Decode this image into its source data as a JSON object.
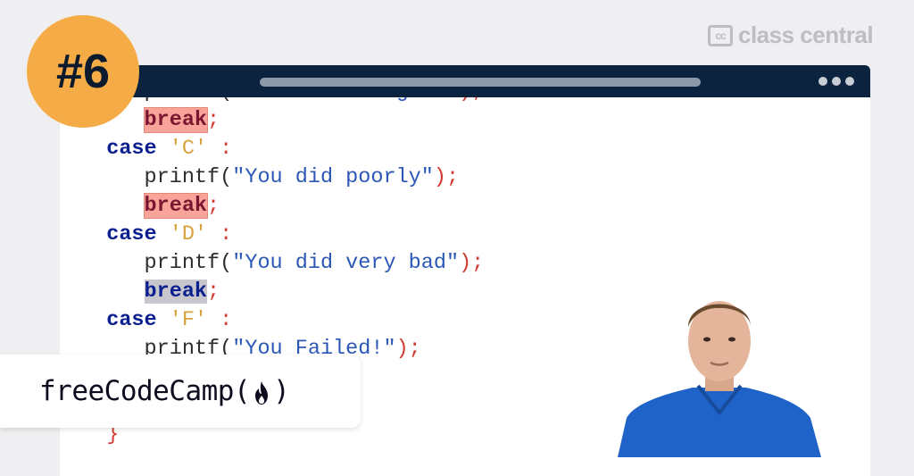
{
  "brand": {
    "cc_mark": "cc",
    "name": "class central"
  },
  "episode": {
    "label": "#6"
  },
  "editor": {
    "lines": [
      {
        "indent": "     ",
        "tokens": [
          {
            "t": "printf(",
            "c": "fn"
          },
          {
            "t": "\"You did alright!\"",
            "c": "str"
          },
          {
            "t": ");",
            "c": "pn"
          }
        ]
      },
      {
        "indent": "     ",
        "tokens": [
          {
            "t": "break",
            "c": "hl-red"
          },
          {
            "t": ";",
            "c": "pn"
          }
        ]
      },
      {
        "indent": "  ",
        "tokens": [
          {
            "t": "case",
            "c": "kw"
          },
          {
            "t": " 'C'",
            "c": "chr"
          },
          {
            "t": " :",
            "c": "pn"
          }
        ]
      },
      {
        "indent": "     ",
        "tokens": [
          {
            "t": "printf(",
            "c": "fn"
          },
          {
            "t": "\"You did poorly\"",
            "c": "str"
          },
          {
            "t": ");",
            "c": "pn"
          }
        ]
      },
      {
        "indent": "     ",
        "tokens": [
          {
            "t": "break",
            "c": "hl-red"
          },
          {
            "t": ";",
            "c": "pn"
          }
        ]
      },
      {
        "indent": "  ",
        "tokens": [
          {
            "t": "case",
            "c": "kw"
          },
          {
            "t": " 'D'",
            "c": "chr"
          },
          {
            "t": " :",
            "c": "pn"
          }
        ]
      },
      {
        "indent": "     ",
        "tokens": [
          {
            "t": "printf(",
            "c": "fn"
          },
          {
            "t": "\"You did very bad\"",
            "c": "str"
          },
          {
            "t": ");",
            "c": "pn"
          }
        ]
      },
      {
        "indent": "     ",
        "tokens": [
          {
            "t": "break",
            "c": "hl-grey"
          },
          {
            "t": ";",
            "c": "pn"
          }
        ]
      },
      {
        "indent": "  ",
        "tokens": [
          {
            "t": "case",
            "c": "kw"
          },
          {
            "t": " 'F'",
            "c": "chr"
          },
          {
            "t": " :",
            "c": "pn"
          }
        ]
      },
      {
        "indent": "     ",
        "tokens": [
          {
            "t": "printf(",
            "c": "fn"
          },
          {
            "t": "\"You Failed!\"",
            "c": "str"
          },
          {
            "t": ");",
            "c": "pn"
          }
        ]
      },
      {
        "indent": "",
        "tokens": []
      },
      {
        "indent": "",
        "tokens": []
      },
      {
        "indent": "  ",
        "tokens": [
          {
            "t": "}",
            "c": "pn"
          }
        ]
      }
    ]
  },
  "logo": {
    "before": "freeCodeCamp(",
    "after": ")"
  },
  "colors": {
    "badge": "#f5ac47",
    "titlebar": "#0c2340",
    "keyword": "#0a1f8f",
    "string": "#2b57b5",
    "char": "#d8a23d",
    "punct": "#d23b32"
  }
}
